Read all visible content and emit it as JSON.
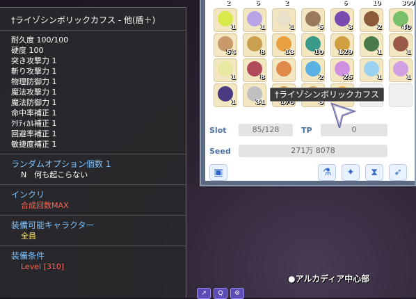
{
  "tooltip": {
    "title": "†ライゾシンボリックカフス - 他(盾＋)",
    "stats": [
      "耐久度 100/100",
      "硬度 100",
      "突き攻撃力 1",
      "斬り攻撃力 1",
      "物理防御力 1",
      "魔法攻撃力 1",
      "魔法防御力 1",
      "命中率補正 1",
      "ｸﾘﾃｨｶﾙ補正 1",
      "回避率補正 1",
      "敏捷度補正 1"
    ],
    "random_option_head": "ランダムオプション個数 1",
    "random_option_val": "N　何も起こらない",
    "incri_head": "インクリ",
    "incri_val": "合成回数MAX",
    "equip_head": "装備可能キャラクター",
    "equip_val": "全員",
    "cond_head": "装備条件",
    "cond_val": "Level [310]"
  },
  "inventory": {
    "slot_label": "Slot",
    "slot_value": "85/128",
    "tp_label": "TP",
    "tp_value": "0",
    "seed_label": "Seed",
    "seed_value": "271万 8078",
    "hover_name": "†ライゾシンボリックカフス",
    "top_counts": [
      "2",
      "6",
      "2",
      "",
      "6",
      "10",
      "300"
    ],
    "rows": [
      [
        {
          "c": "1",
          "col": "#d9e84a"
        },
        {
          "c": "1",
          "col": "#b6a4e6"
        },
        {
          "c": "1",
          "col": "#e8e1c8"
        },
        {
          "c": "5",
          "col": "#9a7a5a"
        },
        {
          "c": "3",
          "col": "#7a4ab0"
        },
        {
          "c": "2",
          "col": "#8a5a3a"
        },
        {
          "c": "40",
          "col": "#7ac06a"
        }
      ],
      [
        {
          "c": "54",
          "col": "#c89a6a"
        },
        {
          "c": "8",
          "col": "#c8a050"
        },
        {
          "c": "13",
          "col": "#e8a040"
        },
        {
          "c": "10",
          "col": "#3a9a8a"
        },
        {
          "c": "129",
          "col": "#d0a040"
        },
        {
          "c": "1",
          "col": "#4a7a4a"
        },
        {
          "c": "1",
          "col": "#9a5a4a"
        }
      ],
      [
        {
          "c": "1",
          "col": "#e8e8a0"
        },
        {
          "c": "8",
          "col": "#b04a5a"
        },
        {
          "c": "",
          "col": "#e08a4a"
        },
        {
          "c": "2",
          "col": "#5ab0e0"
        },
        {
          "c": "25",
          "col": "#d090e0"
        },
        {
          "c": "1",
          "col": "#9ad0f0"
        },
        {
          "c": "1",
          "col": "#d0a0e0"
        }
      ],
      [
        {
          "c": "1",
          "col": "#4a3a80"
        },
        {
          "c": "31",
          "col": "#c0c0c0"
        },
        {
          "c": "170",
          "col": "#d0a060"
        },
        {
          "c": "5",
          "col": "#d0a060"
        },
        {
          "c": "",
          "col": "#f0b040"
        },
        {
          "c": "",
          "col": ""
        },
        {
          "c": "",
          "col": ""
        }
      ]
    ],
    "toolbar_icons": [
      "bag-icon",
      "flask-icon",
      "sparkle-icon",
      "hourglass-icon",
      "wing-icon"
    ]
  },
  "world": {
    "location": "●アルカディア中心部",
    "icons": [
      "↗",
      "Q",
      "⚙"
    ]
  }
}
